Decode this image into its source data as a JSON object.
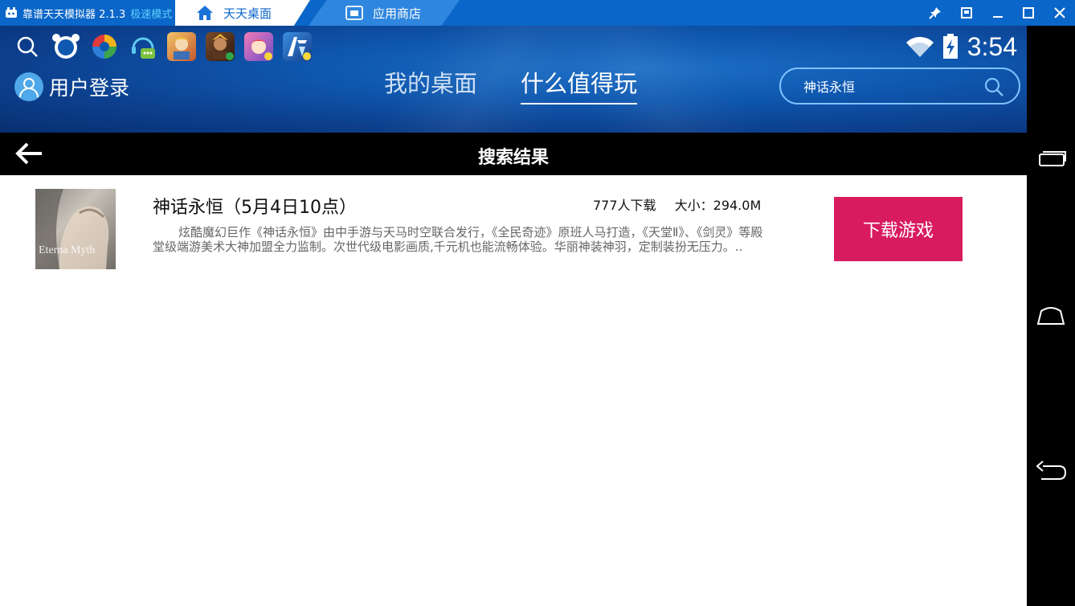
{
  "window": {
    "app_name": "靠谱天天模拟器 2.1.3",
    "mode_label": "极速模式",
    "tabs": [
      {
        "label": "天天桌面",
        "icon": "home-icon",
        "active": true
      },
      {
        "label": "应用商店",
        "icon": "store-icon",
        "active": false
      }
    ],
    "controls": [
      "pin-icon",
      "window-mode-icon",
      "minimize-icon",
      "maximize-icon",
      "close-icon"
    ]
  },
  "status": {
    "time": "3:54",
    "icons": [
      "wifi-icon",
      "battery-charging-icon"
    ]
  },
  "quick_icons": [
    "search-icon",
    "bear-icon",
    "colorful-app-icon",
    "chat-app-icon",
    "game-app-1-icon",
    "game-app-2-icon",
    "game-app-3-icon",
    "game-app-4-icon"
  ],
  "header": {
    "login_label": "用户登录",
    "nav_tabs": [
      {
        "label": "我的桌面",
        "active": false
      },
      {
        "label": "什么值得玩",
        "active": true
      }
    ],
    "search_value": "神话永恒"
  },
  "results": {
    "title": "搜索结果",
    "items": [
      {
        "name": "神话永恒（5月4日10点）",
        "downloads": "777人下载",
        "size": "大小：294.0M",
        "description": "炫酷魔幻巨作《神话永恒》由中手游与天马时空联合发行，《全民奇迹》原班人马打造，《天堂Ⅱ》、《剑灵》等殿堂级端游美术大神加盟全力监制。次世代级电影画质,千元机也能流畅体验。华丽神装神羽，定制装扮无压力。..",
        "button": "下载游戏",
        "thumb_text": "Eterna Myth"
      }
    ]
  },
  "colors": {
    "titlebar": "#0a66c8",
    "accent_button": "#d81b5f",
    "header_gradient": "#0c3f8d"
  }
}
